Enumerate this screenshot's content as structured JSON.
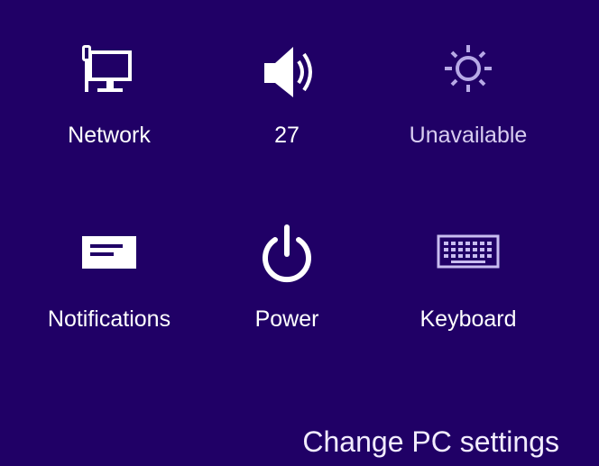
{
  "settings_tiles": [
    {
      "label": "Network",
      "icon": "network-icon"
    },
    {
      "label": "27",
      "icon": "volume-icon"
    },
    {
      "label": "Unavailable",
      "icon": "brightness-icon"
    },
    {
      "label": "Notifications",
      "icon": "notifications-icon"
    },
    {
      "label": "Power",
      "icon": "power-icon"
    },
    {
      "label": "Keyboard",
      "icon": "keyboard-icon"
    }
  ],
  "footer": {
    "change_pc_settings": "Change PC settings"
  },
  "colors": {
    "background": "#200066",
    "text": "#ffffff",
    "disabled_text": "#d8cdf0",
    "disabled_icon": "#b7a9e6"
  }
}
